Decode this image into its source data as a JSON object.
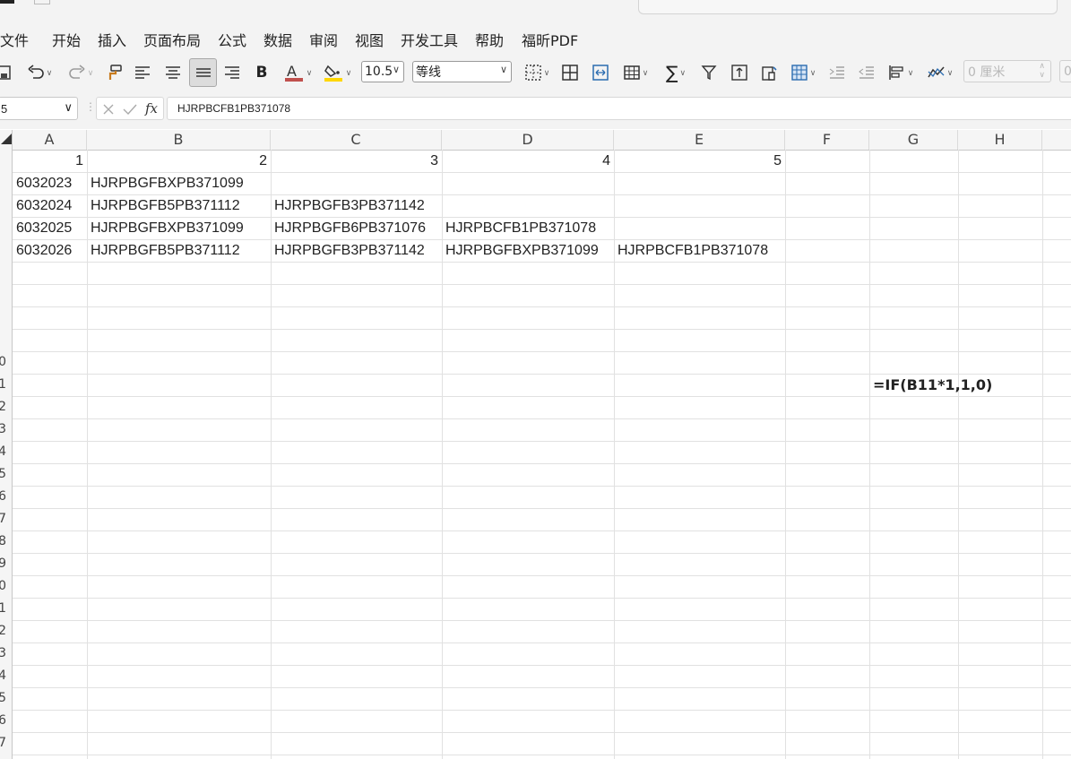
{
  "menu": [
    "文件",
    "开始",
    "插入",
    "页面布局",
    "公式",
    "数据",
    "审阅",
    "视图",
    "开发工具",
    "帮助",
    "福昕PDF"
  ],
  "toolbar": {
    "font_size": "10.5",
    "font_name": "等线",
    "indent_value": "0 厘米",
    "indent_value_2": "0"
  },
  "formula_bar": {
    "cell_ref": "5",
    "fx_label": "fx",
    "content": "HJRPBCFB1PB371078"
  },
  "sheet": {
    "columns": [
      "A",
      "B",
      "C",
      "D",
      "E",
      "F",
      "G",
      "H"
    ],
    "row_labels": [
      "",
      "",
      "",
      "",
      "",
      "",
      "",
      "",
      "",
      "0",
      "1",
      "2",
      "3",
      "4",
      "5",
      "6",
      "7",
      "8",
      "9",
      "0",
      "1",
      "2",
      "3",
      "4",
      "5",
      "6",
      "7"
    ],
    "header_row": [
      "1",
      "2",
      "3",
      "4",
      "5"
    ],
    "rows": [
      [
        "6032023",
        "HJRPBGFBXPB371099",
        "",
        "",
        ""
      ],
      [
        "6032024",
        "HJRPBGFB5PB371112",
        "HJRPBGFB3PB371142",
        "",
        ""
      ],
      [
        "6032025",
        "HJRPBGFBXPB371099",
        "HJRPBGFB6PB371076",
        "HJRPBCFB1PB371078",
        ""
      ],
      [
        "6032026",
        "HJRPBGFB5PB371112",
        "HJRPBGFB3PB371142",
        "HJRPBGFBXPB371099",
        "HJRPBCFB1PB371078"
      ]
    ],
    "note_formula": "=IF(B11*1,1,0)"
  },
  "colors": {
    "font_color_bar": "#c0504d",
    "fill_color_bar": "#ffd700",
    "chrome_bg": "#f3f3f3"
  }
}
